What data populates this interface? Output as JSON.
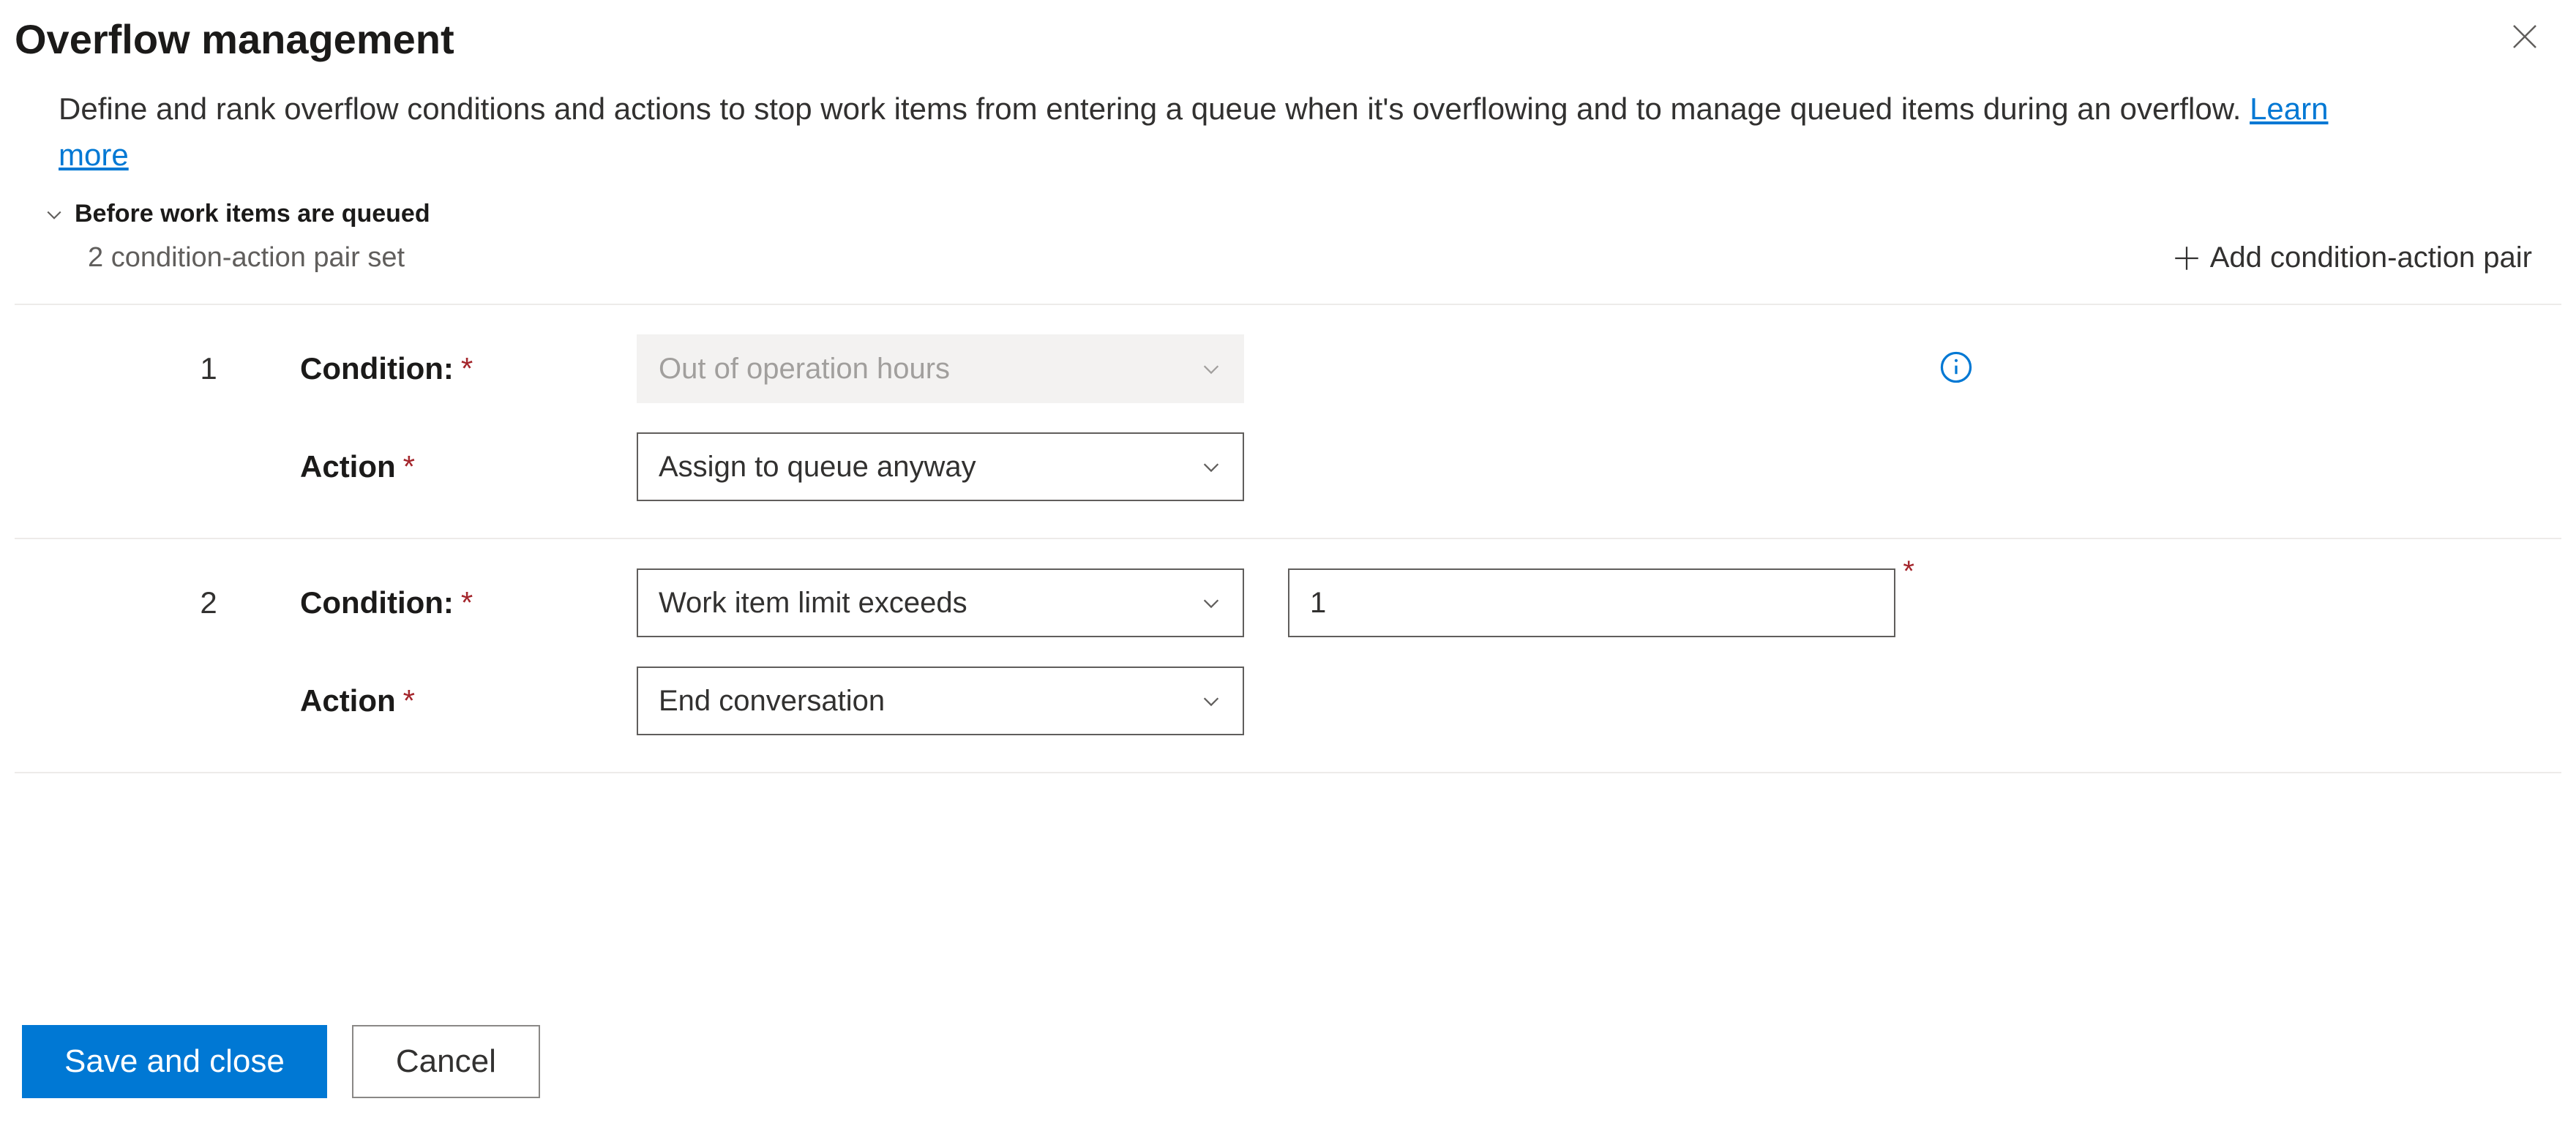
{
  "header": {
    "title": "Overflow management",
    "description": "Define and rank overflow conditions and actions to stop work items from entering a queue when it's overflowing and to manage queued items during an overflow. ",
    "learn_more": "Learn more"
  },
  "section": {
    "title": "Before work items are queued",
    "subtitle": "2 condition-action pair set",
    "add_button": "Add condition-action pair"
  },
  "labels": {
    "condition": "Condition:",
    "action": "Action"
  },
  "pairs": [
    {
      "index": "1",
      "condition_value": "Out of operation hours",
      "condition_disabled": true,
      "action_value": "Assign to queue anyway",
      "has_info": true,
      "extra_input": null
    },
    {
      "index": "2",
      "condition_value": "Work item limit exceeds",
      "condition_disabled": false,
      "action_value": "End conversation",
      "has_info": false,
      "extra_input": "1"
    }
  ],
  "footer": {
    "save": "Save and close",
    "cancel": "Cancel"
  }
}
